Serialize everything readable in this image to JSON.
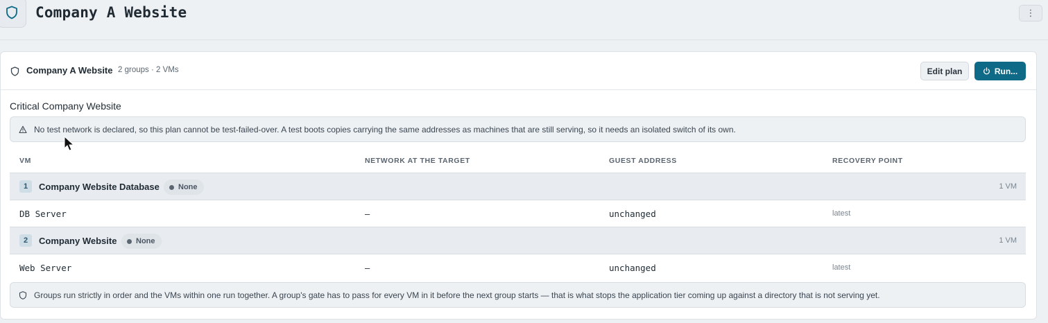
{
  "app": {
    "title": "Company A Website",
    "icon": "shield-icon",
    "menu_icon": "kebab-icon",
    "menu_glyph": "⋮"
  },
  "plan": {
    "icon": "shield-icon",
    "title": "Company A Website",
    "meta": "2 groups · 2 VMs",
    "edit_label": "Edit plan",
    "run_label": "Run...",
    "run_icon": "power-icon"
  },
  "section": {
    "title": "Critical Company Website"
  },
  "warning": {
    "icon": "warning-icon",
    "text": "No test network is declared, so this plan cannot be test-failed-over. A test boots copies carrying the same addresses as machines that are still serving, so it needs an isolated switch of its own."
  },
  "table": {
    "headers": {
      "vm": "VM",
      "network": "NETWORK AT THE TARGET",
      "address": "GUEST ADDRESS",
      "recovery": "RECOVERY POINT"
    },
    "groups": [
      {
        "number": "1",
        "name": "Company Website Database",
        "badge": "None",
        "count": "1 VM",
        "vms": [
          {
            "name": "DB Server",
            "network": "–",
            "address": "unchanged",
            "recovery": "latest"
          }
        ]
      },
      {
        "number": "2",
        "name": "Company Website",
        "badge": "None",
        "count": "1 VM",
        "vms": [
          {
            "name": "Web Server",
            "network": "–",
            "address": "unchanged",
            "recovery": "latest"
          }
        ]
      }
    ]
  },
  "info": {
    "icon": "shield-icon",
    "text": "Groups run strictly in order and the VMs within one run together. A group's gate has to pass for every VM in it before the next group starts — that is what stops the application tier coming up against a directory that is not serving yet."
  },
  "colors": {
    "accent": "#0e6a86",
    "background": "#eef1f4",
    "card": "#ffffff",
    "group_row": "#e8ecf0"
  }
}
